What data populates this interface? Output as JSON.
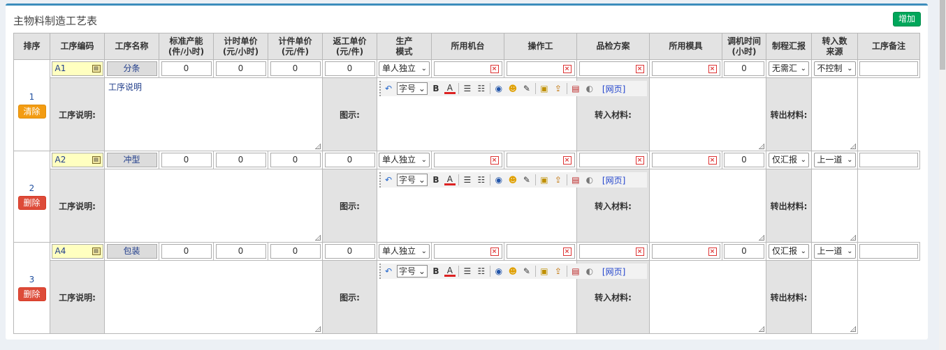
{
  "panel": {
    "title": "主物料制造工艺表",
    "add_label": "增加"
  },
  "headers": {
    "seq": "排序",
    "code": "工序编码",
    "name": "工序名称",
    "std_cap_1": "标准产能",
    "std_cap_2": "(件/小时)",
    "hourly_1": "计时单价",
    "hourly_2": "(元/小时)",
    "piece_1": "计件单价",
    "piece_2": "(元/件)",
    "rework_1": "返工单价",
    "rework_2": "(元/件)",
    "mode_1": "生产",
    "mode_2": "模式",
    "machine": "所用机台",
    "operator": "操作工",
    "qc": "品检方案",
    "mold": "所用模具",
    "adjust_1": "调机时间",
    "adjust_2": "(小时)",
    "report": "制程汇报",
    "source_1": "转入数",
    "source_2": "来源",
    "note": "工序备注"
  },
  "labels": {
    "desc": "工序说明:",
    "diagram": "图示:",
    "in_material": "转入材料:",
    "out_material": "转出材料:"
  },
  "toolbar": {
    "font_label": "字号",
    "web_label": "[网页]"
  },
  "rows": [
    {
      "seq": "1",
      "action": "清除",
      "code": "A1",
      "name": "分条",
      "std_cap": "0",
      "hourly": "0",
      "piece": "0",
      "rework": "0",
      "mode": "单人独立",
      "adjust": "0",
      "report": "无需汇",
      "source": "不控制",
      "desc": "工序说明"
    },
    {
      "seq": "2",
      "action": "删除",
      "code": "A2",
      "name": "冲型",
      "std_cap": "0",
      "hourly": "0",
      "piece": "0",
      "rework": "0",
      "mode": "单人独立",
      "adjust": "0",
      "report": "仅汇报",
      "source": "上一道",
      "desc": ""
    },
    {
      "seq": "3",
      "action": "删除",
      "code": "A4",
      "name": "包装",
      "std_cap": "0",
      "hourly": "0",
      "piece": "0",
      "rework": "0",
      "mode": "单人独立",
      "adjust": "0",
      "report": "仅汇报",
      "source": "上一道",
      "desc": ""
    }
  ],
  "colors": {
    "accent": "#3c8dbc",
    "add": "#00a65a",
    "clear": "#f39c12",
    "delete": "#dd4b39"
  }
}
